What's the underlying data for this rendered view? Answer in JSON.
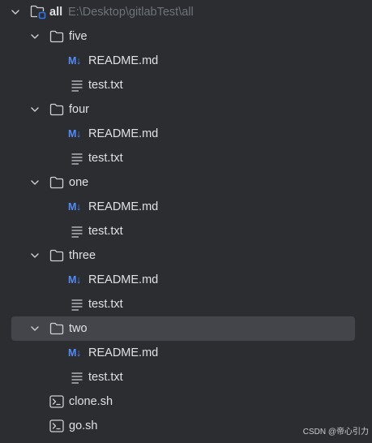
{
  "tree": {
    "root": {
      "label": "all",
      "path": "E:\\Desktop\\gitlabTest\\all",
      "icon": "folder-module-icon",
      "expanded": true
    },
    "folders": [
      {
        "label": "five",
        "icon": "folder-icon",
        "expanded": true,
        "files": [
          {
            "label": "README.md",
            "icon": "markdown-icon",
            "icon_text": "M↓"
          },
          {
            "label": "test.txt",
            "icon": "text-file-icon"
          }
        ]
      },
      {
        "label": "four",
        "icon": "folder-icon",
        "expanded": true,
        "files": [
          {
            "label": "README.md",
            "icon": "markdown-icon",
            "icon_text": "M↓"
          },
          {
            "label": "test.txt",
            "icon": "text-file-icon"
          }
        ]
      },
      {
        "label": "one",
        "icon": "folder-icon",
        "expanded": true,
        "files": [
          {
            "label": "README.md",
            "icon": "markdown-icon",
            "icon_text": "M↓"
          },
          {
            "label": "test.txt",
            "icon": "text-file-icon"
          }
        ]
      },
      {
        "label": "three",
        "icon": "folder-icon",
        "expanded": true,
        "files": [
          {
            "label": "README.md",
            "icon": "markdown-icon",
            "icon_text": "M↓"
          },
          {
            "label": "test.txt",
            "icon": "text-file-icon"
          }
        ]
      },
      {
        "label": "two",
        "icon": "folder-icon",
        "expanded": true,
        "selected": true,
        "files": [
          {
            "label": "README.md",
            "icon": "markdown-icon",
            "icon_text": "M↓"
          },
          {
            "label": "test.txt",
            "icon": "text-file-icon"
          }
        ]
      }
    ],
    "root_files": [
      {
        "label": "clone.sh",
        "icon": "shell-script-icon"
      },
      {
        "label": "go.sh",
        "icon": "shell-script-icon"
      }
    ]
  },
  "colors": {
    "background": "#2b2d30",
    "text": "#dfe1e5",
    "path_text": "#6f737a",
    "selection": "#43454a",
    "icon_stroke": "#ced0d6",
    "markdown_accent": "#548af7",
    "module_accent": "#3574f0"
  },
  "watermark": "CSDN @帝心引力"
}
